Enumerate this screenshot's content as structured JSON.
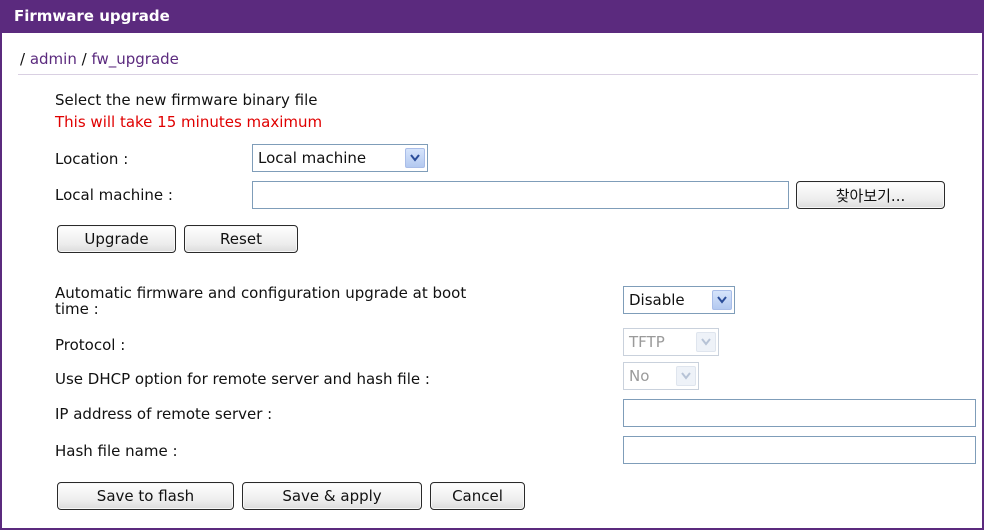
{
  "header": {
    "title": "Firmware upgrade"
  },
  "breadcrumb": {
    "sep": "/",
    "admin": "admin",
    "page": "fw_upgrade"
  },
  "upload": {
    "heading": "Select the new firmware binary file",
    "warning": "This will take 15 minutes maximum",
    "location_label": "Location :",
    "location_value": "Local machine",
    "local_machine_label": "Local machine :",
    "local_machine_value": "",
    "browse_label": "찾아보기...",
    "upgrade_label": "Upgrade",
    "reset_label": "Reset"
  },
  "auto": {
    "auto_label_line1": "Automatic firmware and configuration upgrade at boot",
    "auto_label_line2": "time :",
    "auto_value": "Disable",
    "protocol_label": "Protocol :",
    "protocol_value": "TFTP",
    "dhcp_label": "Use DHCP option for remote server and hash file :",
    "dhcp_value": "No",
    "ip_label": "IP address of remote server :",
    "ip_value": "",
    "hash_label": "Hash file name :",
    "hash_value": ""
  },
  "actions": {
    "save_flash": "Save to flash",
    "save_apply": "Save & apply",
    "cancel": "Cancel"
  },
  "colors": {
    "accent": "#5b2a7e",
    "warning": "#e00000"
  }
}
